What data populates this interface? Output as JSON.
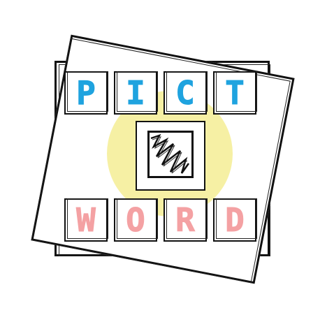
{
  "logo": {
    "top_word": [
      "P",
      "I",
      "C",
      "T"
    ],
    "bottom_word": [
      "W",
      "O",
      "R",
      "D"
    ],
    "picture_icon": "zigzag-sketch-icon",
    "colors": {
      "top_letters": "#1fa3df",
      "bottom_letters": "#f4a1a3",
      "sun": "#f6f0a4",
      "ink": "#111111",
      "background": "#ffffff"
    }
  }
}
